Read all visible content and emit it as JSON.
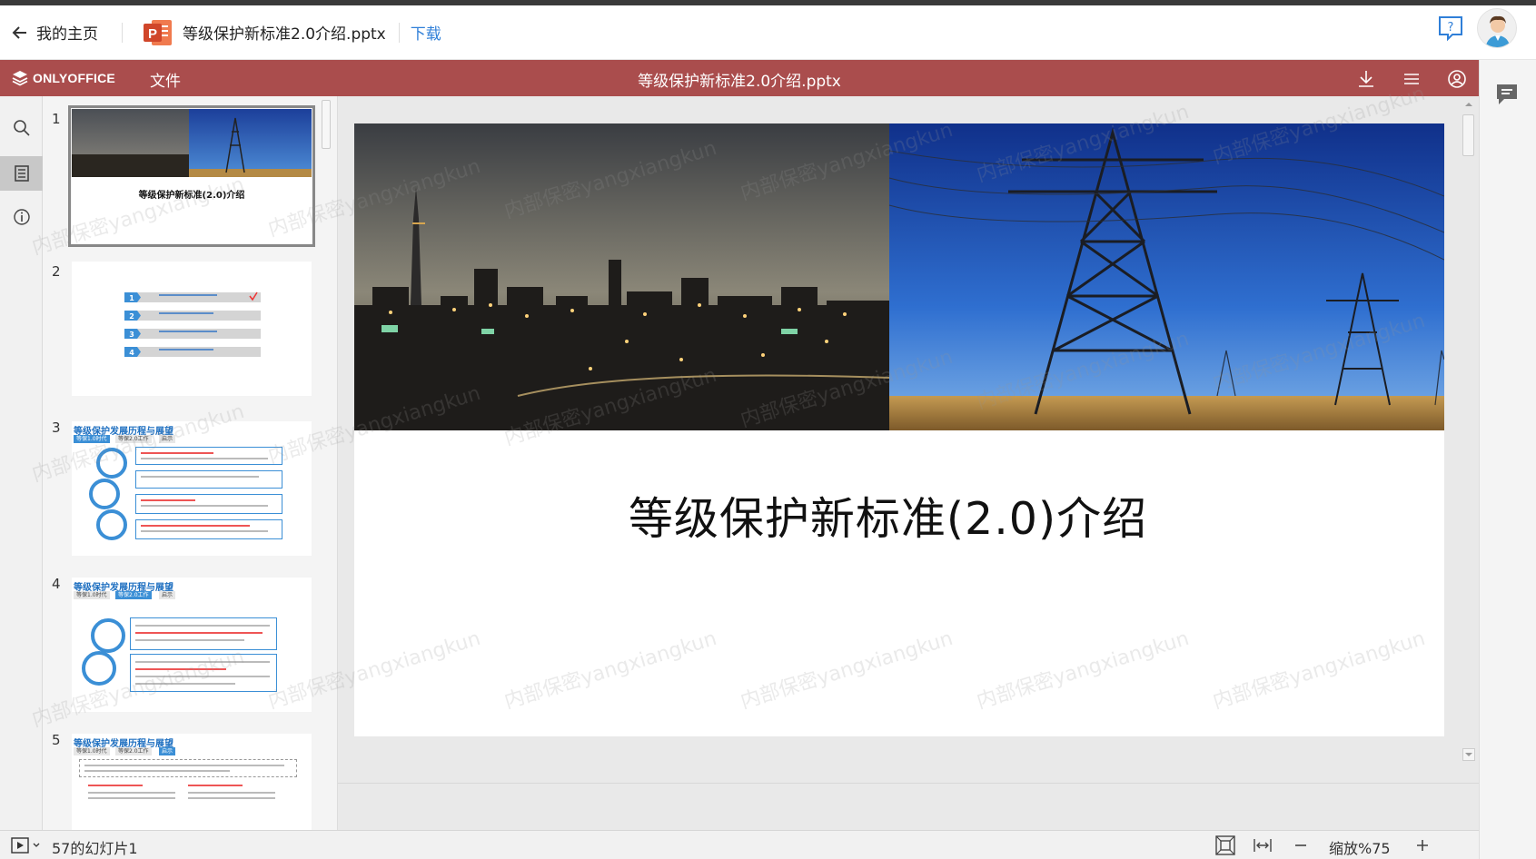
{
  "topbar": {
    "back_label": "我的主页",
    "file_name": "等级保护新标准2.0介绍.pptx",
    "download_label": "下载",
    "pptx_badge": "P"
  },
  "appbar": {
    "brand": "ONLYOFFICE",
    "file_menu": "文件",
    "title": "等级保护新标准2.0介绍.pptx"
  },
  "thumbnails": [
    {
      "number": "1",
      "title": "等级保护新标准(2.0)介绍",
      "selected": true
    },
    {
      "number": "2",
      "items": [
        "1",
        "2",
        "3",
        "4"
      ]
    },
    {
      "number": "3",
      "title": "等级保护发展历程与展望",
      "tabs": [
        "等保1.0时代",
        "等保2.0工作",
        "启示"
      ]
    },
    {
      "number": "4",
      "title": "等级保护发展历程与展望",
      "tabs": [
        "等保1.0时代",
        "等保2.0工作",
        "启示"
      ]
    },
    {
      "number": "5",
      "title": "等级保护发展历程与展望",
      "tabs": [
        "等保1.0时代",
        "等保2.0工作",
        "启示"
      ]
    }
  ],
  "slide": {
    "title": "等级保护新标准(2.0)介绍"
  },
  "watermark": "内部保密yangxiangkun",
  "statusbar": {
    "slide_count": "57的幻灯片1",
    "zoom_label": "缩放%75"
  },
  "colors": {
    "accent": "#aa4d4d",
    "link": "#2f7fd8",
    "thumb_blue": "#3b8fd6"
  },
  "icons": [
    "back-arrow-icon",
    "powerpoint-file-icon",
    "help-icon",
    "user-avatar-icon",
    "onlyoffice-logo-icon",
    "download-icon",
    "hamburger-menu-icon",
    "user-circle-icon",
    "comment-icon",
    "search-icon",
    "slides-panel-icon",
    "info-icon",
    "play-slideshow-icon",
    "fit-slide-icon",
    "fit-width-icon",
    "zoom-out-icon",
    "zoom-in-icon"
  ]
}
